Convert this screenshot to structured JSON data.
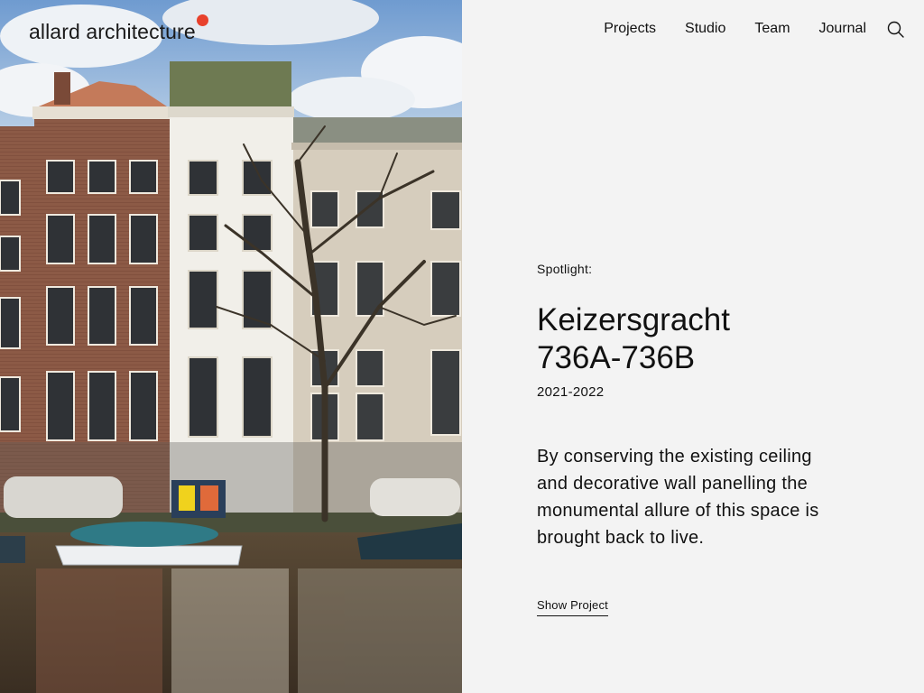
{
  "brand": {
    "name": "allard architecture",
    "dot_color": "#e8412c"
  },
  "nav": {
    "items": [
      {
        "label": "Projects"
      },
      {
        "label": "Studio"
      },
      {
        "label": "Team"
      },
      {
        "label": "Journal"
      }
    ],
    "search_icon": "search-icon"
  },
  "spotlight": {
    "eyebrow": "Spotlight:",
    "title_line1": "Keizersgracht",
    "title_line2": "736A-736B",
    "years": "2021-2022",
    "description": "By conserving the existing ceiling and decorative wall panelling the monumental allure of this space is brought back to live.",
    "cta": "Show Project"
  },
  "colors": {
    "background": "#f3f3f3",
    "text": "#111111",
    "accent": "#e8412c"
  }
}
